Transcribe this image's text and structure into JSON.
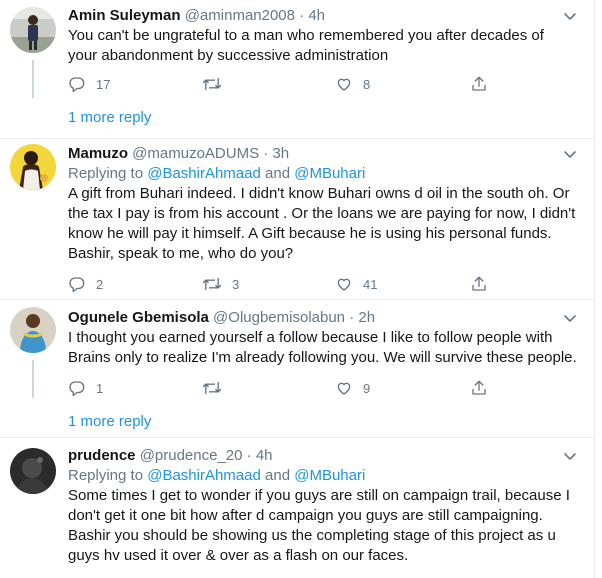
{
  "tweets": [
    {
      "name": "Amin Suleyman",
      "handle": "@aminman2008",
      "sep": "·",
      "time": "4h",
      "text_lines": [
        "You can't be ungrateful to a man who remembered you after decades of",
        "your abandonment by successive administration"
      ],
      "replies": "17",
      "retweets": "",
      "likes": "8",
      "more_reply": "1 more reply"
    },
    {
      "name": "Mamuzo",
      "handle": "@mamuzoADUMS",
      "sep": "·",
      "time": "3h",
      "reply_prefix": "Replying to ",
      "reply_user1": "@BashirAhmaad",
      "reply_and": " and ",
      "reply_user2": "@MBuhari",
      "text_lines": [
        "A gift from Buhari indeed. I didn't know Buhari owns d oil in the south oh. Or",
        "the tax I pay is from his account . Or the loans we are paying for now, I didn't",
        "know he will pay it himself. A Gift because he is using his personal funds.",
        "Bashir, speak to me, who do you?"
      ],
      "replies": "2",
      "retweets": "3",
      "likes": "41"
    },
    {
      "name": "Ogunele Gbemisola",
      "handle": "@Olugbemisolabun",
      "sep": "·",
      "time": "2h",
      "text_lines": [
        "I thought you earned yourself a follow because I like to follow people with",
        "Brains only to realize I'm already following you. We will survive these people."
      ],
      "replies": "1",
      "retweets": "",
      "likes": "9",
      "more_reply": "1 more reply"
    },
    {
      "name": "prudence",
      "handle": "@prudence_20",
      "sep": "·",
      "time": "4h",
      "reply_prefix": "Replying to ",
      "reply_user1": "@BashirAhmaad",
      "reply_and": " and ",
      "reply_user2": "@MBuhari",
      "text_lines": [
        "Some times I get to wonder if you guys are still on campaign trail, because I",
        "don't get it one bit how after d campaign you guys are still campaigning.",
        "Bashir you should be showing us the completing stage of this project as u",
        "guys hv used it over & over as a flash on our faces."
      ]
    }
  ],
  "icons": {
    "reply": "reply-icon",
    "retweet": "retweet-icon",
    "like": "heart-icon",
    "share": "share-icon",
    "caret": "chevron-down-icon"
  },
  "colors": {
    "link": "#1b95e0",
    "secondary": "#657786",
    "text": "#14171a",
    "divider": "#e6ecf0"
  }
}
